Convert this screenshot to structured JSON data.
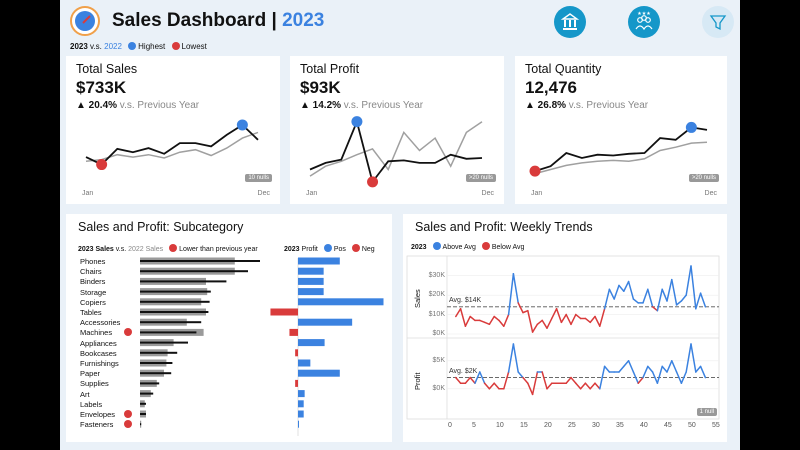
{
  "header": {
    "title": "Sales Dashboard",
    "separator": "|",
    "year": "2023"
  },
  "top_legend": {
    "current": "2023",
    "vs": "v.s.",
    "previous": "2022",
    "highest": "Highest",
    "lowest": "Lowest"
  },
  "kpis": [
    {
      "title": "Total Sales",
      "value": "$733K",
      "change": "▲ 20.4%",
      "vs_text": "v.s. Previous Year",
      "jan": "Jan",
      "dec": "Dec",
      "nulls": "10 nulls"
    },
    {
      "title": "Total Profit",
      "value": "$93K",
      "change": "▲ 14.2%",
      "vs_text": "v.s. Previous Year",
      "jan": "Jan",
      "dec": "Dec",
      "nulls": ">20 nulls"
    },
    {
      "title": "Total Quantity",
      "value": "12,476",
      "change": "▲ 26.8%",
      "vs_text": "v.s. Previous Year",
      "jan": "Jan",
      "dec": "Dec",
      "nulls": ">20 nulls"
    }
  ],
  "subcategory": {
    "title": "Sales and Profit: Subcategory",
    "legend_sales_year": "2023 Sales",
    "legend_vs": "v.s.",
    "legend_prev": "2022 Sales",
    "legend_lower": "Lower than previous year",
    "legend_profit_year": "2023",
    "legend_profit": "Profit",
    "legend_pos": "Pos",
    "legend_neg": "Neg",
    "rows": [
      {
        "name": "Phones",
        "sales_2023": 100,
        "sales_2022": 79,
        "profit": 44,
        "lower": false
      },
      {
        "name": "Chairs",
        "sales_2023": 90,
        "sales_2022": 79,
        "profit": 27,
        "lower": false
      },
      {
        "name": "Binders",
        "sales_2023": 72,
        "sales_2022": 55,
        "profit": 27,
        "lower": false
      },
      {
        "name": "Storage",
        "sales_2023": 59,
        "sales_2022": 56,
        "profit": 27,
        "lower": false
      },
      {
        "name": "Copiers",
        "sales_2023": 58,
        "sales_2022": 51,
        "profit": 90,
        "lower": false
      },
      {
        "name": "Tables",
        "sales_2023": 57,
        "sales_2022": 55,
        "profit": -29,
        "lower": false
      },
      {
        "name": "Accessories",
        "sales_2023": 51,
        "sales_2022": 39,
        "profit": 57,
        "lower": false
      },
      {
        "name": "Machines",
        "sales_2023": 47,
        "sales_2022": 53,
        "profit": -9,
        "lower": true
      },
      {
        "name": "Appliances",
        "sales_2023": 40,
        "sales_2022": 28,
        "profit": 28,
        "lower": false
      },
      {
        "name": "Bookcases",
        "sales_2023": 31,
        "sales_2022": 23,
        "profit": -3,
        "lower": false
      },
      {
        "name": "Furnishings",
        "sales_2023": 27,
        "sales_2022": 22,
        "profit": 13,
        "lower": false
      },
      {
        "name": "Paper",
        "sales_2023": 26,
        "sales_2022": 20,
        "profit": 44,
        "lower": false
      },
      {
        "name": "Supplies",
        "sales_2023": 16,
        "sales_2022": 14,
        "profit": -3,
        "lower": false
      },
      {
        "name": "Art",
        "sales_2023": 11,
        "sales_2022": 9,
        "profit": 7,
        "lower": false
      },
      {
        "name": "Labels",
        "sales_2023": 5,
        "sales_2022": 4,
        "profit": 6,
        "lower": false
      },
      {
        "name": "Envelopes",
        "sales_2023": 5,
        "sales_2022": 5,
        "profit": 6,
        "lower": true
      },
      {
        "name": "Fasteners",
        "sales_2023": 1,
        "sales_2022": 1,
        "profit": 1,
        "lower": true
      }
    ]
  },
  "weekly": {
    "title": "Sales and Profit: Weekly Trends",
    "legend_year": "2023",
    "legend_above": "Above Avg",
    "legend_below": "Below Avg",
    "sales_axis": "Sales",
    "profit_axis": "Profit",
    "sales_ticks": [
      "$30K",
      "$20K",
      "$10K",
      "$0K"
    ],
    "profit_ticks": [
      "$5K",
      "$0K"
    ],
    "avg_sales": "Avg. $14K",
    "avg_profit": "Avg. $2K",
    "x_ticks": [
      "0",
      "5",
      "10",
      "15",
      "20",
      "25",
      "30",
      "35",
      "40",
      "45",
      "50",
      "55"
    ],
    "nulls": "1 null"
  },
  "colors": {
    "blue": "#3b82e0",
    "red": "#d93b3b",
    "grey": "#a0a0a0",
    "black": "#111111",
    "accent": "#1597c9"
  },
  "chart_data": [
    {
      "type": "line",
      "title": "Total Sales",
      "series": [
        {
          "name": "2023",
          "values": [
            35,
            26,
            45,
            41,
            46,
            39,
            52,
            52,
            48,
            62,
            74,
            56
          ]
        },
        {
          "name": "2022",
          "values": [
            30,
            32,
            38,
            35,
            38,
            34,
            41,
            44,
            37,
            46,
            58,
            65
          ]
        }
      ]
    },
    {
      "type": "line",
      "title": "Total Profit",
      "series": [
        {
          "name": "2023",
          "values": [
            20,
            28,
            32,
            78,
            5,
            30,
            31,
            28,
            28,
            38,
            33,
            34
          ]
        },
        {
          "name": "2022",
          "values": [
            12,
            24,
            30,
            38,
            45,
            20,
            65,
            43,
            58,
            24,
            65,
            78
          ]
        }
      ]
    },
    {
      "type": "line",
      "title": "Total Quantity",
      "series": [
        {
          "name": "2023",
          "values": [
            18,
            24,
            40,
            34,
            38,
            37,
            39,
            40,
            58,
            56,
            71,
            68
          ]
        },
        {
          "name": "2022",
          "values": [
            15,
            20,
            25,
            28,
            30,
            31,
            30,
            33,
            43,
            47,
            52,
            53
          ]
        }
      ]
    },
    {
      "type": "line",
      "title": "Sales and Profit: Weekly Trends",
      "x": [
        1,
        2,
        3,
        4,
        5,
        6,
        7,
        8,
        9,
        10,
        11,
        12,
        13,
        14,
        15,
        16,
        17,
        18,
        19,
        20,
        21,
        22,
        23,
        24,
        25,
        26,
        27,
        28,
        29,
        30,
        31,
        32,
        33,
        34,
        35,
        36,
        37,
        38,
        39,
        40,
        41,
        42,
        43,
        44,
        45,
        46,
        47,
        48,
        49,
        50,
        51,
        52,
        53
      ],
      "series": [
        {
          "name": "Sales",
          "values": [
            9,
            13,
            4,
            9,
            7,
            7,
            6,
            5,
            9,
            7,
            4,
            10,
            31,
            16,
            11,
            12,
            1,
            5,
            7,
            3,
            8,
            13,
            6,
            10,
            5,
            10,
            8,
            8,
            6,
            9,
            4,
            13,
            23,
            18,
            25,
            22,
            27,
            18,
            16,
            16,
            23,
            14,
            12,
            23,
            17,
            28,
            15,
            17,
            20,
            35,
            13,
            21,
            14
          ]
        },
        {
          "name": "Profit",
          "values": [
            2,
            1,
            1,
            2,
            1,
            3,
            1,
            0,
            1,
            0,
            0,
            3,
            8,
            3,
            2,
            1,
            -1,
            3,
            3,
            0,
            1,
            1,
            1,
            1,
            2,
            1,
            0,
            1,
            0,
            1,
            0,
            4,
            3,
            3,
            3,
            4,
            5,
            3,
            1,
            2,
            4,
            3,
            1,
            4,
            3,
            5,
            3,
            1,
            3,
            8,
            3,
            4,
            2
          ]
        }
      ],
      "avg": {
        "Sales": 14,
        "Profit": 2
      }
    }
  ]
}
